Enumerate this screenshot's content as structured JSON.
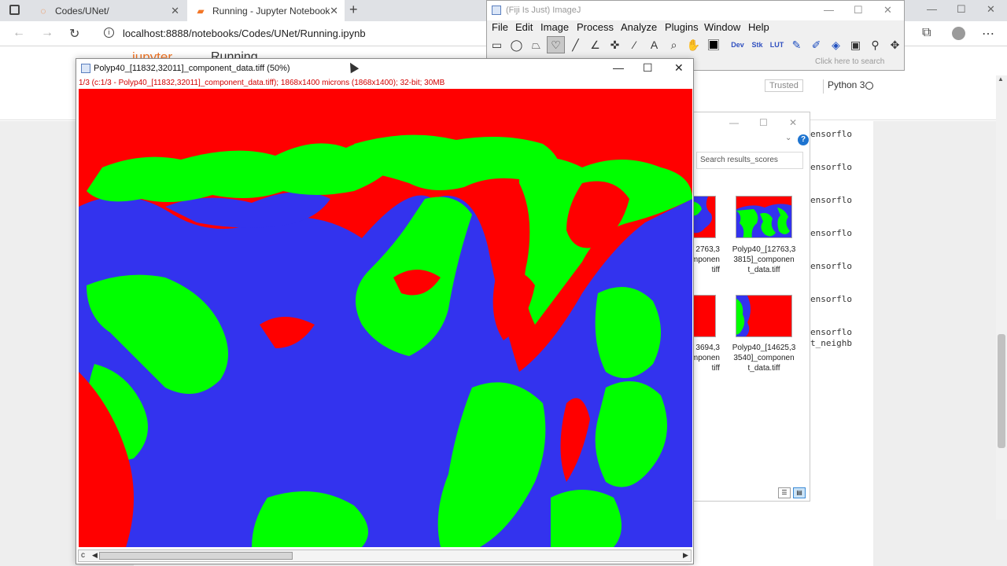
{
  "browser": {
    "tabs": [
      {
        "label": "Codes/UNet/"
      },
      {
        "label": "Running - Jupyter Notebook"
      }
    ],
    "url": "localhost:8888/notebooks/Codes/UNet/Running.ipynb"
  },
  "jupyter": {
    "logo_text": "jupyter",
    "notebook_title": "Running",
    "trusted_label": "Trusted",
    "kernel_label": "Python 3",
    "code_lines": [
      "ensorflo",
      "ensorflo",
      "ensorflo",
      "ensorflo",
      "ensorflo",
      "ensorflo",
      "ensorflo",
      "t_neighb"
    ]
  },
  "explorer": {
    "search_placeholder": "Search results_scores",
    "files": [
      {
        "name": "Polyp40_[12763,3"
      },
      {
        "name": "Polyp40_[12763,33815]_component_data.tiff"
      },
      {
        "name": "3694,3"
      },
      {
        "name": "Polyp40_[14625,33540]_component_data.tiff"
      }
    ],
    "file_name_lines": {
      "f1a": "2763,3",
      "f1b": "componen",
      "f1c": "tiff",
      "f2a": "Polyp40_[12763,3",
      "f2b": "3815]_componen",
      "f2c": "t_data.tiff",
      "f3a": "3694,3",
      "f3b": "componen",
      "f3c": "tiff",
      "f4a": "Polyp40_[14625,3",
      "f4b": "3540]_componen",
      "f4c": "t_data.tiff"
    },
    "help_label": "?"
  },
  "imagej": {
    "title": "(Fiji Is Just) ImageJ",
    "menus": [
      "File",
      "Edit",
      "Image",
      "Process",
      "Analyze",
      "Plugins",
      "Window",
      "Help"
    ],
    "tools": [
      "rectangle-tool",
      "oval-tool",
      "polygon-tool",
      "freehand-tool",
      "line-tool",
      "angle-tool",
      "point-tool",
      "wand-tool",
      "text-tool",
      "zoom-tool",
      "hand-tool",
      "color-picker"
    ],
    "extra_tools": [
      "Dev",
      "Stk",
      "LUT"
    ],
    "status_text": "Click here to search"
  },
  "image_window": {
    "title": "Polyp40_[11832,32011]_component_data.tiff (50%)",
    "info": "1/3 (c:1/3 - Polyp40_[11832,32011]_component_data.tiff); 1868x1400 microns (1868x1400); 32-bit; 30MB",
    "channel_label": "c"
  },
  "colors": {
    "red": "#ff0000",
    "green": "#00ff00",
    "blue": "#3333ee"
  }
}
